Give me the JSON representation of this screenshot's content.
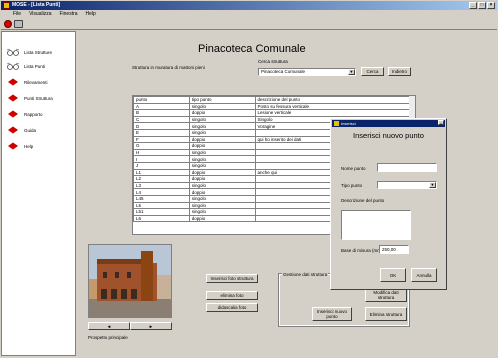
{
  "window": {
    "title": "MOSE - [Lista Punti]"
  },
  "menu": [
    "File",
    "Visualizza",
    "Finestra",
    "Help"
  ],
  "sidebar": {
    "items": [
      {
        "label": "Lista Strutture",
        "icon": "list-glasses-icon"
      },
      {
        "label": "Lista Punti",
        "icon": "list-glasses-icon"
      },
      {
        "label": "Rilevamenti",
        "icon": "red-diamond-icon"
      },
      {
        "label": "Punti Struttura",
        "icon": "red-diamond-icon"
      },
      {
        "label": "Rapporto",
        "icon": "red-diamond-icon"
      },
      {
        "label": "Guida",
        "icon": "red-diamond-icon"
      },
      {
        "label": "Help",
        "icon": "red-diamond-icon"
      }
    ]
  },
  "main": {
    "title": "Pinacoteca Comunale",
    "subtitle": "Struttura in muratura di mattoni pieni",
    "search": {
      "label": "Cerca struttura",
      "value": "Pinacoteca Comunale",
      "search_button": "Cerca",
      "back_button": "Indietro"
    },
    "table": {
      "headers": [
        "punto",
        "tipo punto",
        "descrizione del punto"
      ],
      "rows": [
        [
          "A",
          "singolo",
          "Posto su fessura verticale"
        ],
        [
          "B",
          "doppio",
          "Lesione verticale"
        ],
        [
          "C",
          "singolo",
          "Singolo"
        ],
        [
          "D",
          "singolo",
          "Voragine"
        ],
        [
          "E",
          "singolo",
          ""
        ],
        [
          "F",
          "doppio",
          "qui ho inserito dei dati"
        ],
        [
          "G",
          "doppio",
          ""
        ],
        [
          "H",
          "singolo",
          ""
        ],
        [
          "I",
          "singolo",
          ""
        ],
        [
          "J",
          "singolo",
          ""
        ],
        [
          "L1",
          "doppio",
          "anche qui"
        ],
        [
          "L2",
          "doppio",
          ""
        ],
        [
          "L3",
          "singolo",
          ""
        ],
        [
          "L4",
          "doppio",
          ""
        ],
        [
          "L45",
          "singolo",
          ""
        ],
        [
          "L5",
          "singolo",
          ""
        ],
        [
          "L51",
          "singolo",
          ""
        ],
        [
          "L6",
          "doppio",
          ""
        ]
      ]
    },
    "photo_buttons": {
      "insert": "Inserisci foto struttura",
      "delete": "elimina foto",
      "caption": "didascalia foto"
    },
    "photo_caption": "Prospetto principale",
    "nav": {
      "prev": "◄",
      "next": "►"
    },
    "manage_group": {
      "label": "Gestione dati struttura",
      "modify": "Modifica dati struttura",
      "insert_point": "Inserisci nuovo punto",
      "delete": "Elimina struttura"
    }
  },
  "dialog": {
    "title": "Inserisci",
    "heading": "Inserisci nuovo punto",
    "name_label": "Nome punto",
    "type_label": "Tipo punto",
    "desc_label": "Descrizione del punto",
    "base_label": "Base di misura (mm)",
    "base_value": "250,00",
    "ok": "OK",
    "cancel": "Annulla"
  },
  "colors": {
    "title_bar": "#0a246a",
    "window_bg": "#d4d0c8",
    "accent_red": "#cc0000"
  }
}
